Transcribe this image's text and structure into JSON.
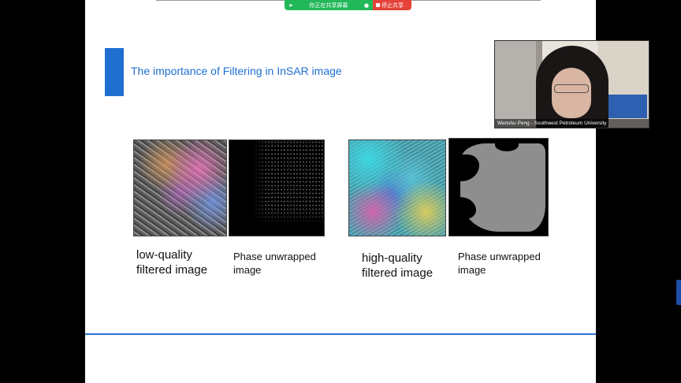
{
  "share_bar": {
    "status_label": "你正在共享屏幕",
    "stop_label": "停止共享",
    "status_color": "#22b85a",
    "stop_color": "#e5433a"
  },
  "slide": {
    "title": "The importance of Filtering in InSAR image",
    "accent_color": "#1f6fd1",
    "captions": {
      "low_quality": "low-quality\nfiltered image",
      "phase_unwrapped_1": "Phase unwrapped\nimage",
      "high_quality": "high-quality\nfiltered image",
      "phase_unwrapped_2": "Phase unwrapped\nimage"
    }
  },
  "video": {
    "participant_label": "Wenshu Peng - Southwest Petroleum University"
  }
}
